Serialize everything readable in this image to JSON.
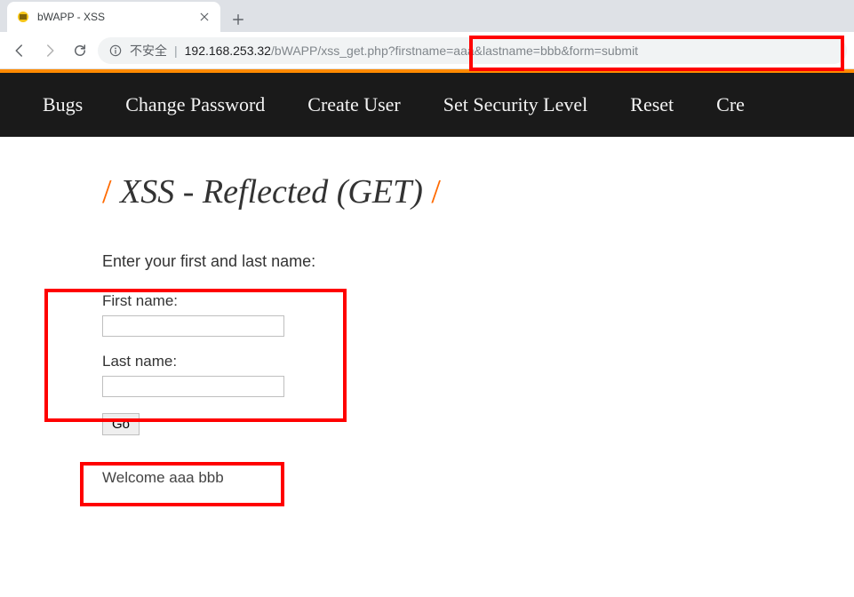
{
  "browser": {
    "tab_title": "bWAPP - XSS",
    "insecure_label": "不安全",
    "url_host": "192.168.253.32",
    "url_path": "/bWAPP/xss_get.php",
    "url_query": "?firstname=aaa&lastname=bbb&form=submit"
  },
  "nav": {
    "items": [
      "Bugs",
      "Change Password",
      "Create User",
      "Set Security Level",
      "Reset",
      "Cre"
    ]
  },
  "page": {
    "title_prefix": "/",
    "title_text": " XSS - Reflected (GET) ",
    "title_suffix": "/",
    "prompt": "Enter your first and last name:",
    "first_label": "First name:",
    "last_label": "Last name:",
    "first_value": "",
    "last_value": "",
    "go_label": "Go",
    "welcome": "Welcome aaa bbb"
  }
}
